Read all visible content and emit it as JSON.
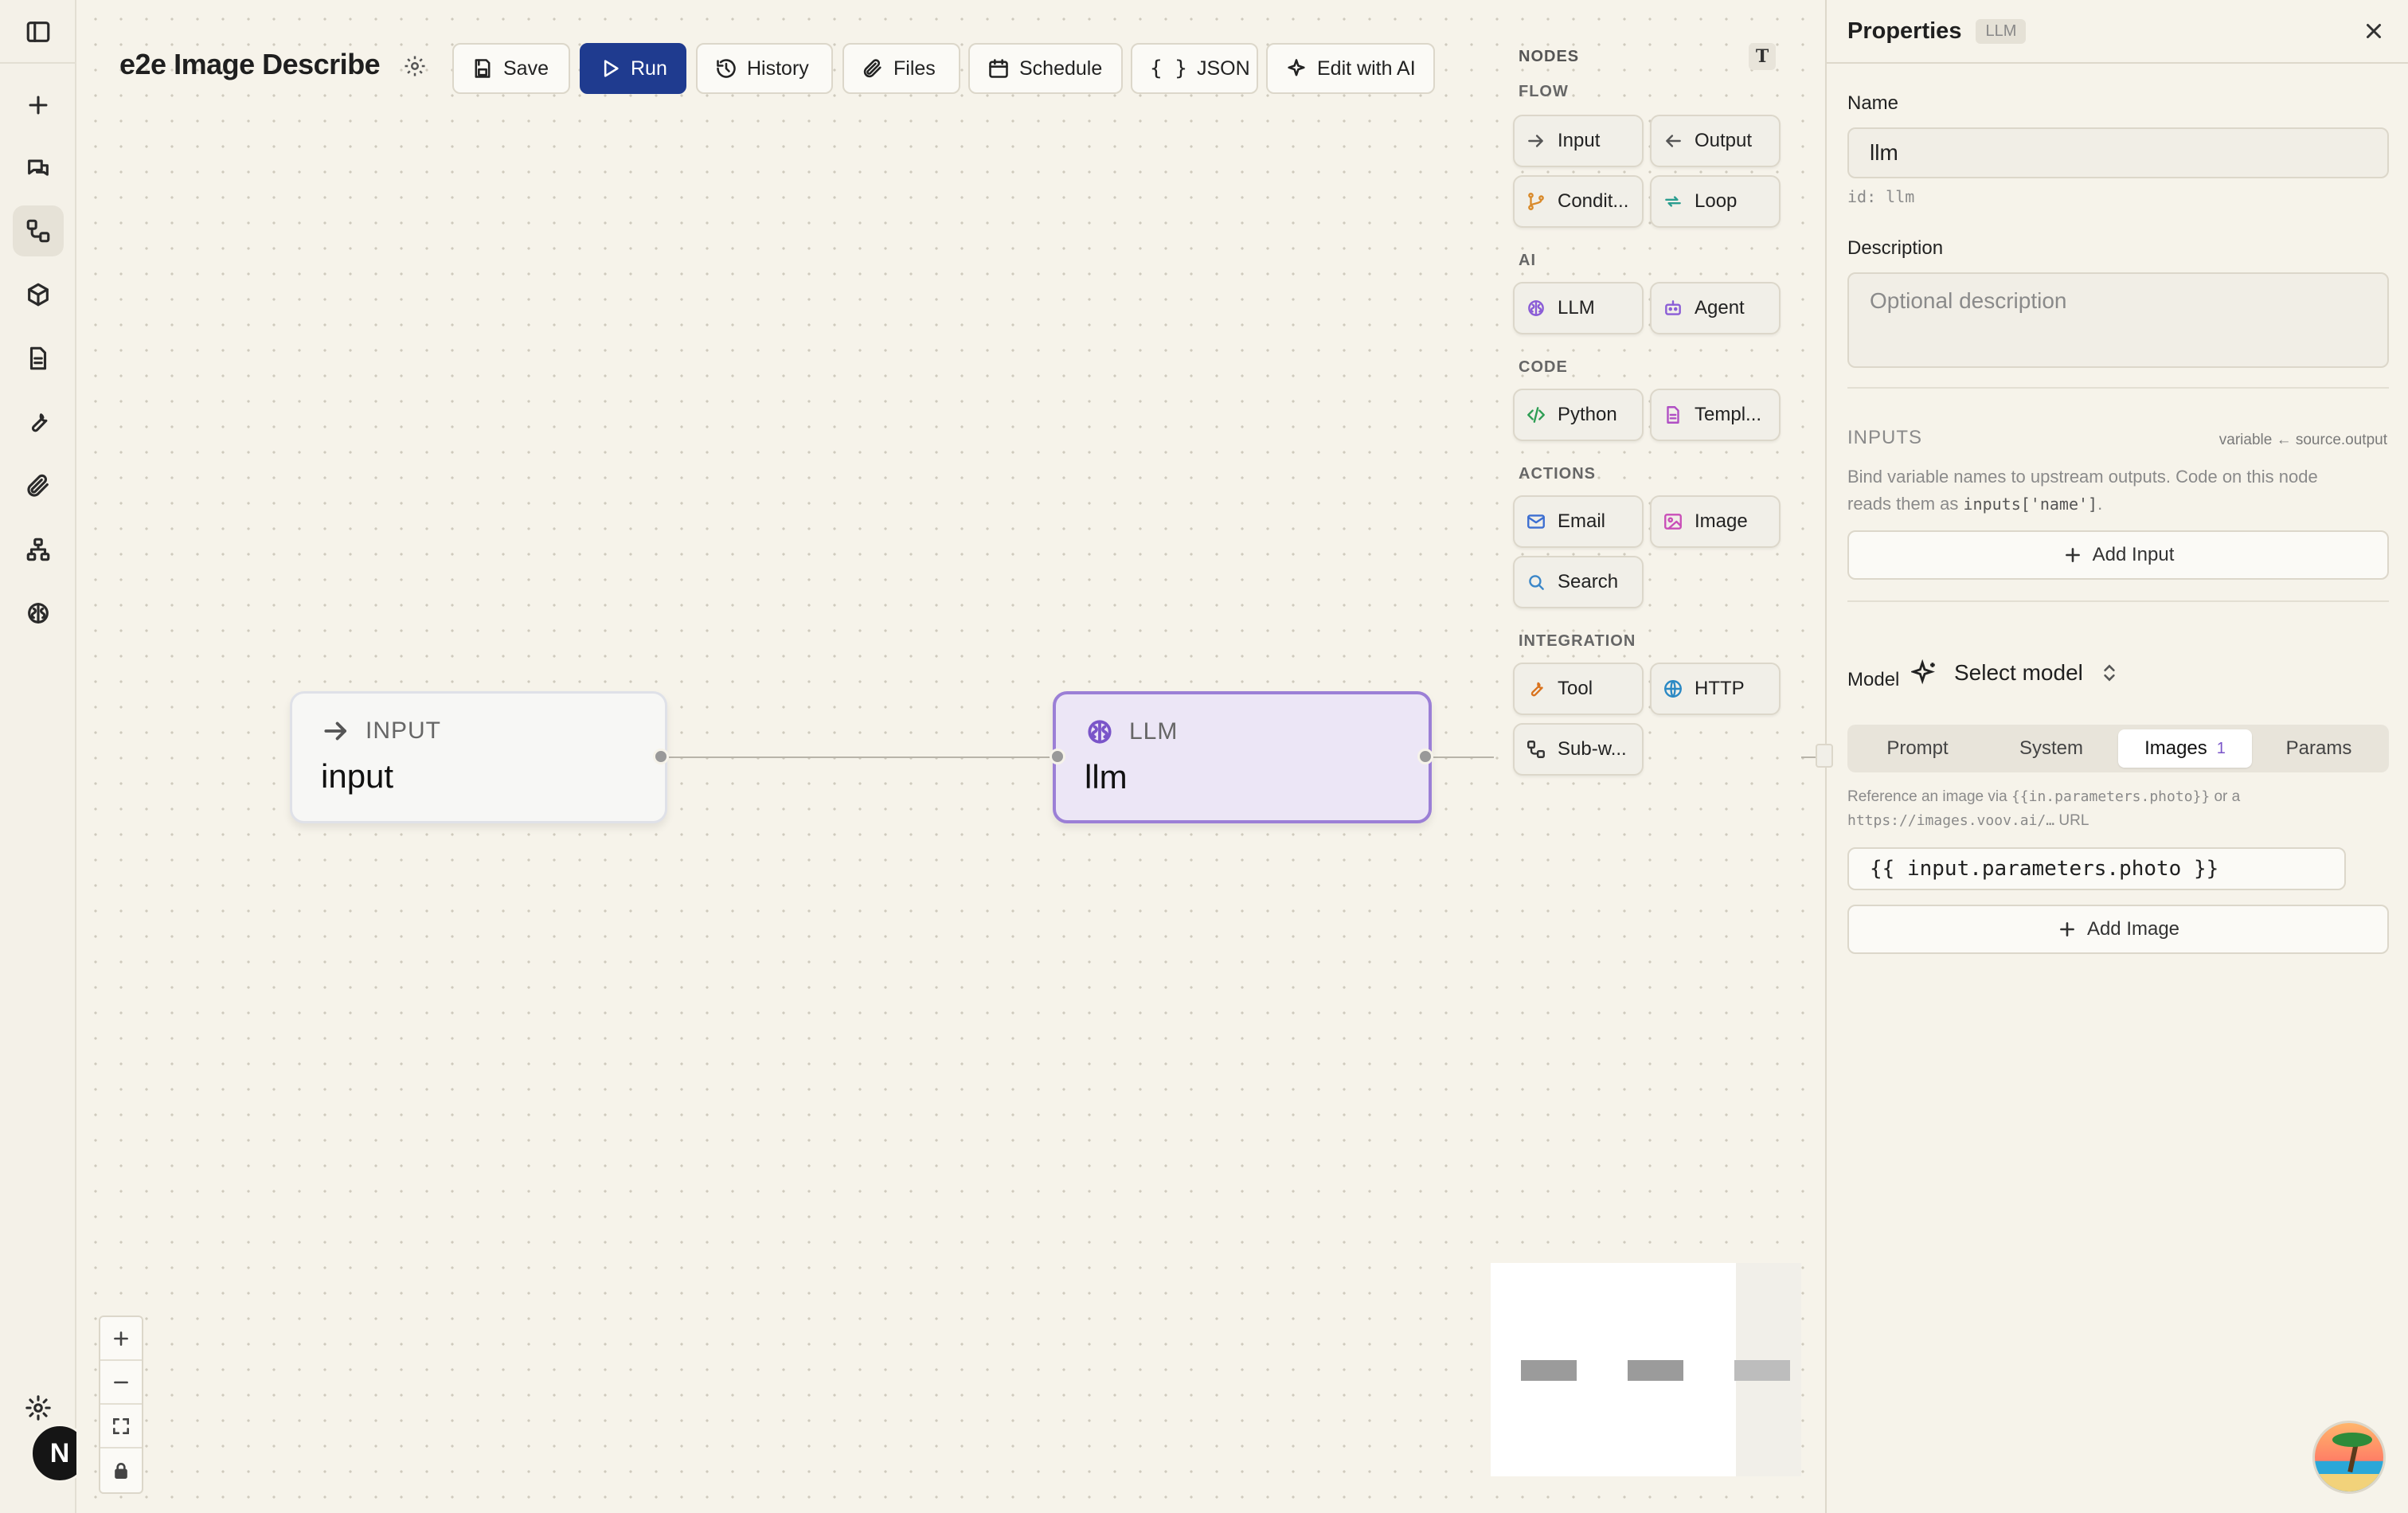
{
  "workflow": {
    "title": "e2e Image Describe"
  },
  "toolbar": {
    "save": "Save",
    "run": "Run",
    "history": "History",
    "files": "Files",
    "schedule": "Schedule",
    "json": "JSON",
    "edit_ai": "Edit with AI"
  },
  "palette": {
    "title": "NODES",
    "sections": {
      "flow": "FLOW",
      "ai": "AI",
      "code": "CODE",
      "actions": "ACTIONS",
      "integration": "INTEGRATION"
    },
    "items": {
      "input": "Input",
      "output": "Output",
      "condition": "Condit...",
      "loop": "Loop",
      "llm": "LLM",
      "agent": "Agent",
      "python": "Python",
      "template": "Templ...",
      "email": "Email",
      "image": "Image",
      "search": "Search",
      "tool": "Tool",
      "http": "HTTP",
      "subworkflow": "Sub-w..."
    },
    "colors": {
      "flow": "#555555",
      "condition": "#d98a2b",
      "loop": "#2a9d8f",
      "ai": "#8a5cd6",
      "python": "#2e9e54",
      "template": "#b04fc4",
      "email": "#3d6fd1",
      "image": "#c94fb8",
      "search": "#3a86c8",
      "tool": "#d9731f",
      "http": "#2b89c4",
      "subworkflow": "#333333"
    }
  },
  "canvas": {
    "nodes": [
      {
        "type": "INPUT",
        "name": "input",
        "icon": "arrow-right-icon"
      },
      {
        "type": "LLM",
        "name": "llm",
        "icon": "brain-icon"
      }
    ]
  },
  "properties": {
    "title": "Properties",
    "badge": "LLM",
    "name_label": "Name",
    "name_value": "llm",
    "id_text": "id: llm",
    "description_label": "Description",
    "description_placeholder": "Optional description",
    "inputs_label": "INPUTS",
    "inputs_hint_right": "variable ← source.output",
    "inputs_help_1": "Bind variable names to upstream outputs. Code on this node",
    "inputs_help_2a": "reads them as ",
    "inputs_help_code": "inputs['name']",
    "inputs_help_2b": ".",
    "add_input": "Add Input",
    "model_label": "Model",
    "model_value": "Select model",
    "tabs": {
      "prompt": "Prompt",
      "system": "System",
      "images": "Images",
      "images_count": "1",
      "params": "Params"
    },
    "images_help_1a": "Reference an image via ",
    "images_help_1code": "{{in.parameters.photo}}",
    "images_help_1b": " or a",
    "images_help_2code": "https://images.voov.ai/…",
    "images_help_2b": " URL",
    "image_ref": "{{ input.parameters.photo }}",
    "add_image": "Add Image"
  },
  "user": {
    "initial": "N"
  }
}
